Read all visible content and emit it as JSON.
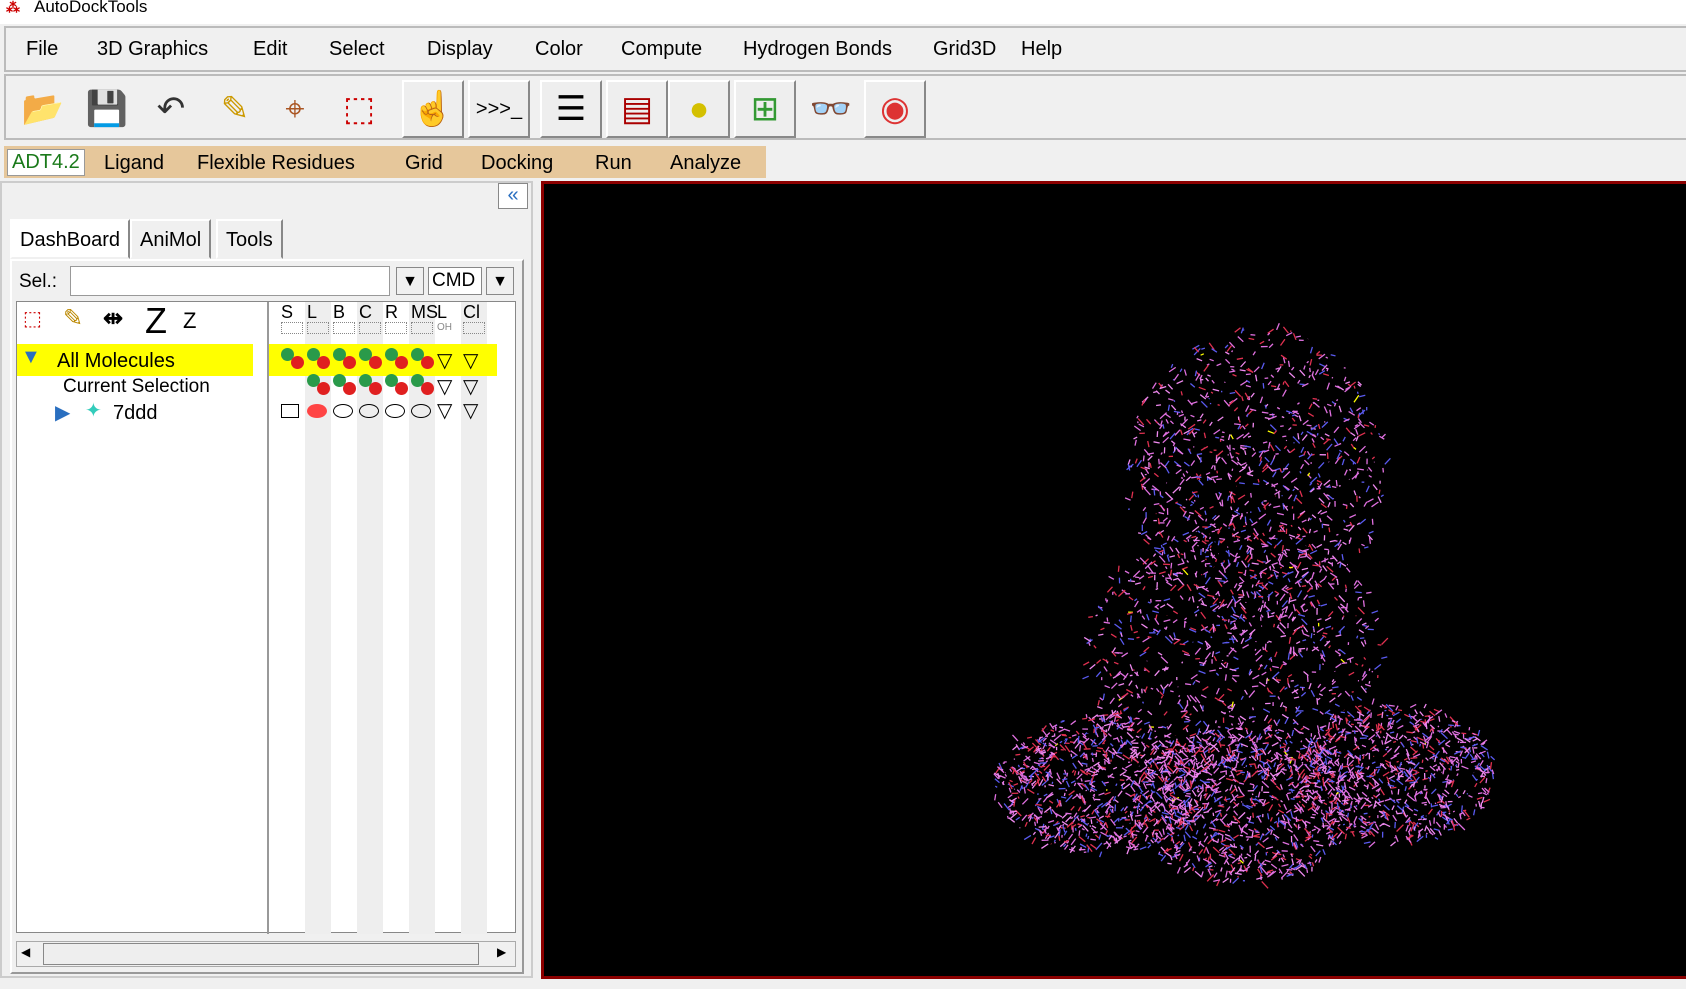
{
  "title": "AutoDockTools",
  "menu": [
    "File",
    "3D Graphics",
    "Edit",
    "Select",
    "Display",
    "Color",
    "Compute",
    "Hydrogen Bonds",
    "Grid3D",
    "Help"
  ],
  "toolbar_icons": [
    "open-file-icon",
    "save-icon",
    "undo-icon",
    "pencil-icon",
    "crosshair-icon",
    "select-pointer-icon",
    "hand-pointer-icon",
    "python-shell-icon",
    "text-lines-icon",
    "dashboard-icon",
    "colored-shapes-icon",
    "network-icon",
    "stereo-glasses-icon",
    "fog-icon"
  ],
  "adt_tabs": [
    "ADT4.2",
    "Ligand",
    "Flexible Residues",
    "Grid",
    "Docking",
    "Run",
    "Analyze"
  ],
  "panel_tabs": [
    "DashBoard",
    "AniMol",
    "Tools"
  ],
  "sel": {
    "label": "Sel.:",
    "value": "",
    "mode": "CMD"
  },
  "columns": [
    "S",
    "L",
    "B",
    "C",
    "R",
    "MS",
    "L",
    "Cl"
  ],
  "column_sub": [
    "",
    "",
    "",
    "",
    "",
    "",
    "OH",
    ""
  ],
  "tree": [
    {
      "label": "All Molecules",
      "highlighted": true
    },
    {
      "label": "Current Selection",
      "highlighted": false
    },
    {
      "label": "7ddd",
      "highlighted": false
    }
  ],
  "colors": {
    "molecule": "#e070e0",
    "accent_red": "#8b0000",
    "highlight": "#ffff00"
  }
}
